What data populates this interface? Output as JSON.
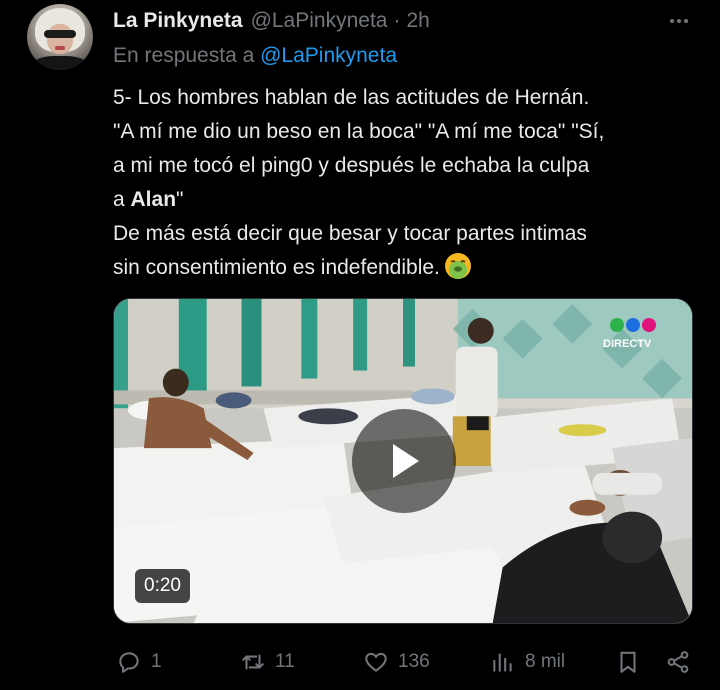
{
  "author": {
    "name": "La Pinkyneta",
    "handle": "@LaPinkyneta",
    "separator": "·",
    "time": "2h"
  },
  "reply": {
    "prefix": "En respuesta a ",
    "mention": "@LaPinkyneta"
  },
  "text": {
    "line1": "5- Los hombres hablan de las actitudes de Hernán.",
    "line2": "\"A mí me dio un beso en la boca\" \"A mí me toca\" \"Sí,",
    "line3": "a mi me tocó el ping0 y después le echaba la culpa",
    "line4_pre": "a ",
    "line4_bold": "Alan",
    "line4_post": "\"",
    "line5": "De más está decir que besar y tocar partes intimas",
    "line6": "sin consentimiento es indefendible.",
    "emoji": "nauseated-face-emoji"
  },
  "media": {
    "duration": "0:20",
    "logo_text": "DIRECTV",
    "logo_dot_colors": [
      "#2bb24c",
      "#1d6fe0",
      "#e0147c"
    ]
  },
  "actions": {
    "replies": "1",
    "retweets": "11",
    "likes": "136",
    "views": "8 mil"
  },
  "colors": {
    "background": "#000000",
    "text": "#e7e9ea",
    "muted": "#71767b",
    "link": "#1d9bf0"
  }
}
